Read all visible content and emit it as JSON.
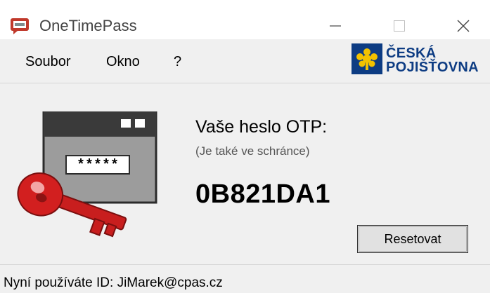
{
  "window": {
    "title": "OneTimePass",
    "minimize_symbol": "—",
    "close_symbol": "✕",
    "icons": {
      "app": "chat-window-icon",
      "minimize": "minimize-icon",
      "maximize": "maximize-icon",
      "close": "close-icon"
    }
  },
  "menu": {
    "items": [
      {
        "label": "Soubor"
      },
      {
        "label": "Okno"
      },
      {
        "label": "?"
      }
    ]
  },
  "brand": {
    "line1": "ČESKÁ",
    "line2": "POJIŠŤOVNA",
    "colors": {
      "blue": "#0d3c83",
      "gold": "#f2c200"
    }
  },
  "otp": {
    "heading": "Vaše heslo OTP:",
    "note": "(Je také ve schránce)",
    "code": "0B821DA1",
    "masked_field": "*****"
  },
  "buttons": {
    "reset": "Resetovat"
  },
  "status": {
    "text": "Nyní používáte ID: JiMarek@cpas.cz"
  },
  "colors": {
    "window_bg": "#f0f0f0",
    "titlebar_bg": "#ffffff",
    "key_red": "#d21f1f"
  }
}
